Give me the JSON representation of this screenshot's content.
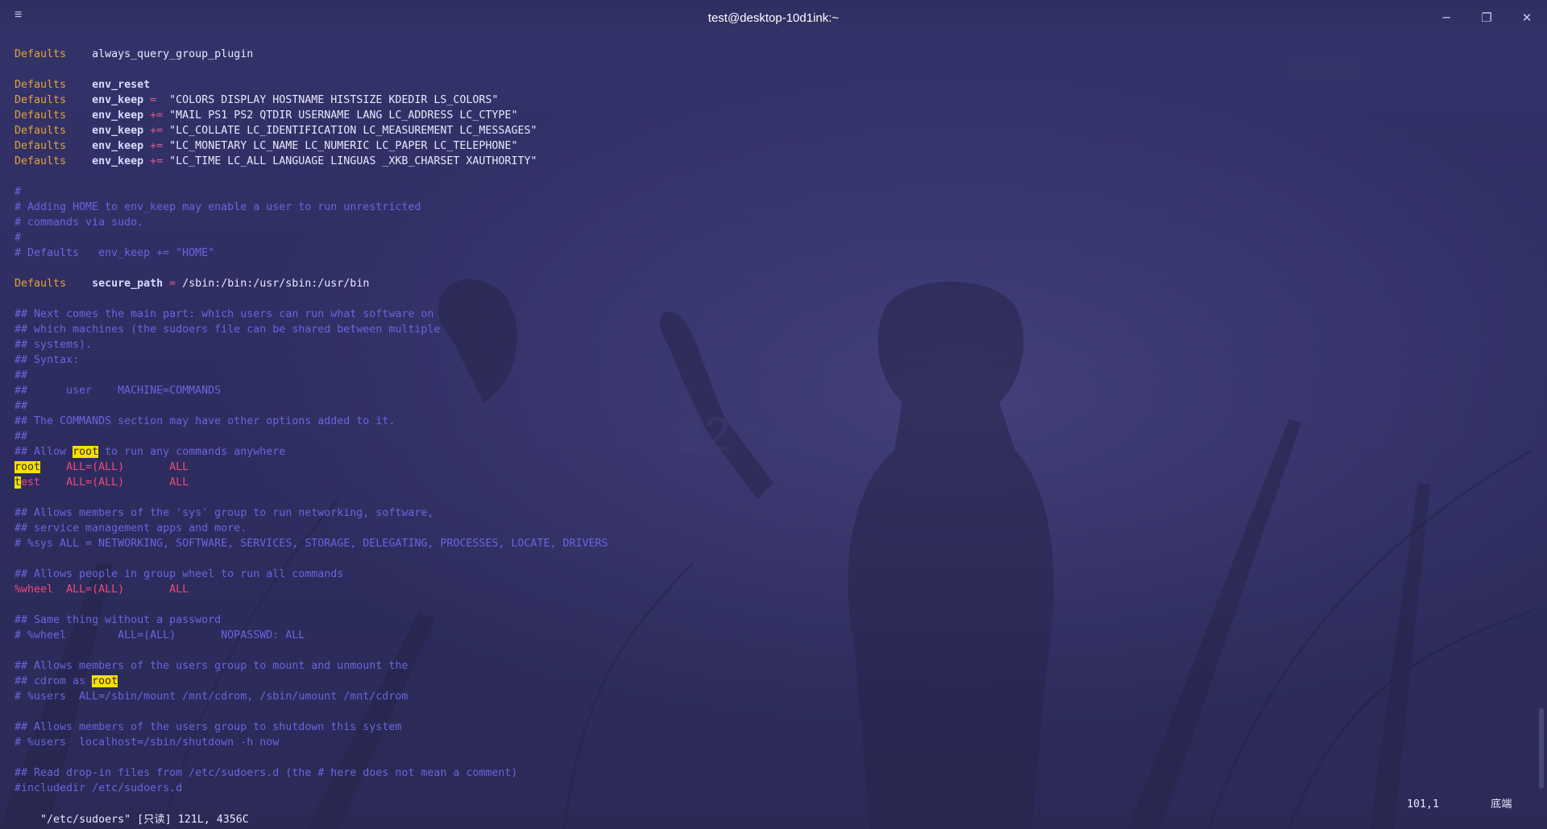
{
  "window": {
    "title": "test@desktop-10d1ink:~",
    "icons": {
      "menu": "hamburger-icon",
      "minimize": "minimize-icon",
      "restore": "restore-icon",
      "close": "close-icon"
    }
  },
  "editor": {
    "lines": [
      [
        {
          "t": "Defaults",
          "c": "def"
        },
        {
          "t": "    "
        },
        {
          "t": "always_query_group_plugin",
          "c": "plain"
        }
      ],
      [],
      [
        {
          "t": "Defaults",
          "c": "def"
        },
        {
          "t": "    "
        },
        {
          "t": "env_reset",
          "c": "key"
        }
      ],
      [
        {
          "t": "Defaults",
          "c": "def"
        },
        {
          "t": "    "
        },
        {
          "t": "env_keep",
          "c": "key"
        },
        {
          "t": " = ",
          "c": "op"
        },
        {
          "t": " \"COLORS DISPLAY HOSTNAME HISTSIZE KDEDIR LS_COLORS\"",
          "c": "str"
        }
      ],
      [
        {
          "t": "Defaults",
          "c": "def"
        },
        {
          "t": "    "
        },
        {
          "t": "env_keep",
          "c": "key"
        },
        {
          "t": " += ",
          "c": "op"
        },
        {
          "t": "\"MAIL PS1 PS2 QTDIR USERNAME LANG LC_ADDRESS LC_CTYPE\"",
          "c": "str"
        }
      ],
      [
        {
          "t": "Defaults",
          "c": "def"
        },
        {
          "t": "    "
        },
        {
          "t": "env_keep",
          "c": "key"
        },
        {
          "t": " += ",
          "c": "op"
        },
        {
          "t": "\"LC_COLLATE LC_IDENTIFICATION LC_MEASUREMENT LC_MESSAGES\"",
          "c": "str"
        }
      ],
      [
        {
          "t": "Defaults",
          "c": "def"
        },
        {
          "t": "    "
        },
        {
          "t": "env_keep",
          "c": "key"
        },
        {
          "t": " += ",
          "c": "op"
        },
        {
          "t": "\"LC_MONETARY LC_NAME LC_NUMERIC LC_PAPER LC_TELEPHONE\"",
          "c": "str"
        }
      ],
      [
        {
          "t": "Defaults",
          "c": "def"
        },
        {
          "t": "    "
        },
        {
          "t": "env_keep",
          "c": "key"
        },
        {
          "t": " += ",
          "c": "op"
        },
        {
          "t": "\"LC_TIME LC_ALL LANGUAGE LINGUAS _XKB_CHARSET XAUTHORITY\"",
          "c": "str"
        }
      ],
      [],
      [
        {
          "t": "#",
          "c": "cmt"
        }
      ],
      [
        {
          "t": "# Adding HOME to env_keep may enable a user to run unrestricted",
          "c": "cmt"
        }
      ],
      [
        {
          "t": "# commands via sudo.",
          "c": "cmt"
        }
      ],
      [
        {
          "t": "#",
          "c": "cmt"
        }
      ],
      [
        {
          "t": "# Defaults   env_keep += \"HOME\"",
          "c": "cmt"
        }
      ],
      [],
      [
        {
          "t": "Defaults",
          "c": "def"
        },
        {
          "t": "    "
        },
        {
          "t": "secure_path",
          "c": "key"
        },
        {
          "t": " = ",
          "c": "op"
        },
        {
          "t": "/sbin:/bin:/usr/sbin:/usr/bin",
          "c": "path"
        }
      ],
      [],
      [
        {
          "t": "## Next comes the main part: which users can run what software on",
          "c": "cmt"
        }
      ],
      [
        {
          "t": "## which machines (the sudoers file can be shared between multiple",
          "c": "cmt"
        }
      ],
      [
        {
          "t": "## systems).",
          "c": "cmt"
        }
      ],
      [
        {
          "t": "## Syntax:",
          "c": "cmt"
        }
      ],
      [
        {
          "t": "##",
          "c": "cmt"
        }
      ],
      [
        {
          "t": "##      user    MACHINE=COMMANDS",
          "c": "cmt"
        }
      ],
      [
        {
          "t": "##",
          "c": "cmt"
        }
      ],
      [
        {
          "t": "## The COMMANDS section may have other options added to it.",
          "c": "cmt"
        }
      ],
      [
        {
          "t": "##",
          "c": "cmt"
        }
      ],
      [
        {
          "t": "## Allow ",
          "c": "cmt"
        },
        {
          "t": "root",
          "c": "hl"
        },
        {
          "t": " to run any commands anywhere",
          "c": "cmt"
        }
      ],
      [
        {
          "t": "root",
          "c": "hl"
        },
        {
          "t": "    "
        },
        {
          "t": "ALL=(ALL)",
          "c": "red"
        },
        {
          "t": "       "
        },
        {
          "t": "ALL",
          "c": "red"
        }
      ],
      [
        {
          "t": "t",
          "c": "cursor"
        },
        {
          "t": "est",
          "c": "red"
        },
        {
          "t": "    "
        },
        {
          "t": "ALL=(ALL)",
          "c": "red"
        },
        {
          "t": "       "
        },
        {
          "t": "ALL",
          "c": "red"
        }
      ],
      [],
      [
        {
          "t": "## Allows members of the 'sys' group to run networking, software,",
          "c": "cmt"
        }
      ],
      [
        {
          "t": "## service management apps and more.",
          "c": "cmt"
        }
      ],
      [
        {
          "t": "# %sys ALL = NETWORKING, SOFTWARE, SERVICES, STORAGE, DELEGATING, PROCESSES, LOCATE, DRIVERS",
          "c": "cmt"
        }
      ],
      [],
      [
        {
          "t": "## Allows people in group wheel to run all commands",
          "c": "cmt"
        }
      ],
      [
        {
          "t": "%wheel",
          "c": "red"
        },
        {
          "t": "  "
        },
        {
          "t": "ALL=(ALL)",
          "c": "red"
        },
        {
          "t": "       "
        },
        {
          "t": "ALL",
          "c": "red"
        }
      ],
      [],
      [
        {
          "t": "## Same thing without a password",
          "c": "cmt"
        }
      ],
      [
        {
          "t": "# %wheel        ALL=(ALL)       NOPASSWD: ALL",
          "c": "cmt"
        }
      ],
      [],
      [
        {
          "t": "## Allows members of the users group to mount and unmount the",
          "c": "cmt"
        }
      ],
      [
        {
          "t": "## cdrom as ",
          "c": "cmt"
        },
        {
          "t": "root",
          "c": "hl"
        }
      ],
      [
        {
          "t": "# %users  ALL=/sbin/mount /mnt/cdrom, /sbin/umount /mnt/cdrom",
          "c": "cmt"
        }
      ],
      [],
      [
        {
          "t": "## Allows members of the users group to shutdown this system",
          "c": "cmt"
        }
      ],
      [
        {
          "t": "# %users  localhost=/sbin/shutdown -h now",
          "c": "cmt"
        }
      ],
      [],
      [
        {
          "t": "## Read drop-in files from /etc/sudoers.d (the # here does not mean a comment)",
          "c": "cmt"
        }
      ],
      [
        {
          "t": "#includedir /etc/sudoers.d",
          "c": "cmt"
        }
      ]
    ]
  },
  "status": {
    "file_info": "\"/etc/sudoers\" [只读] 121L, 4356C",
    "cursor_pos": "101,1",
    "scroll_pos": "底端"
  }
}
